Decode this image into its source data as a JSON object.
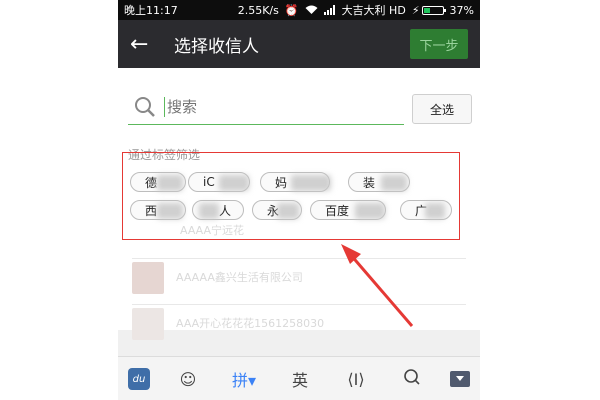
{
  "status_bar": {
    "time": "晚上11:17",
    "speed": "2.55K/s",
    "carrier": "大吉大利 HD",
    "battery": "37%",
    "battery_level": 0.37
  },
  "title_bar": {
    "title": "选择收信人",
    "next_label": "下一步"
  },
  "search": {
    "placeholder": "搜索",
    "select_all_label": "全选"
  },
  "filter": {
    "label": "通过标签筛选",
    "tags": [
      "德",
      "iC",
      "妈",
      "装",
      "西",
      "人",
      "永",
      "百度",
      "广"
    ]
  },
  "list_items": [
    {
      "text": "AAAA宁远花"
    },
    {
      "text": "AAAAA鑫兴生活有限公司"
    },
    {
      "text": "AAA开心花花花1561258030"
    }
  ],
  "keyboard": {
    "du_label": "du",
    "pinyin_label": "拼",
    "english_label": "英",
    "cursor_label": "⟨I⟩"
  },
  "colors": {
    "title_bg": "#2b2b2f",
    "next_bg": "#2e7d32",
    "highlight_border": "#e53935",
    "search_underline": "#5cb85c"
  }
}
